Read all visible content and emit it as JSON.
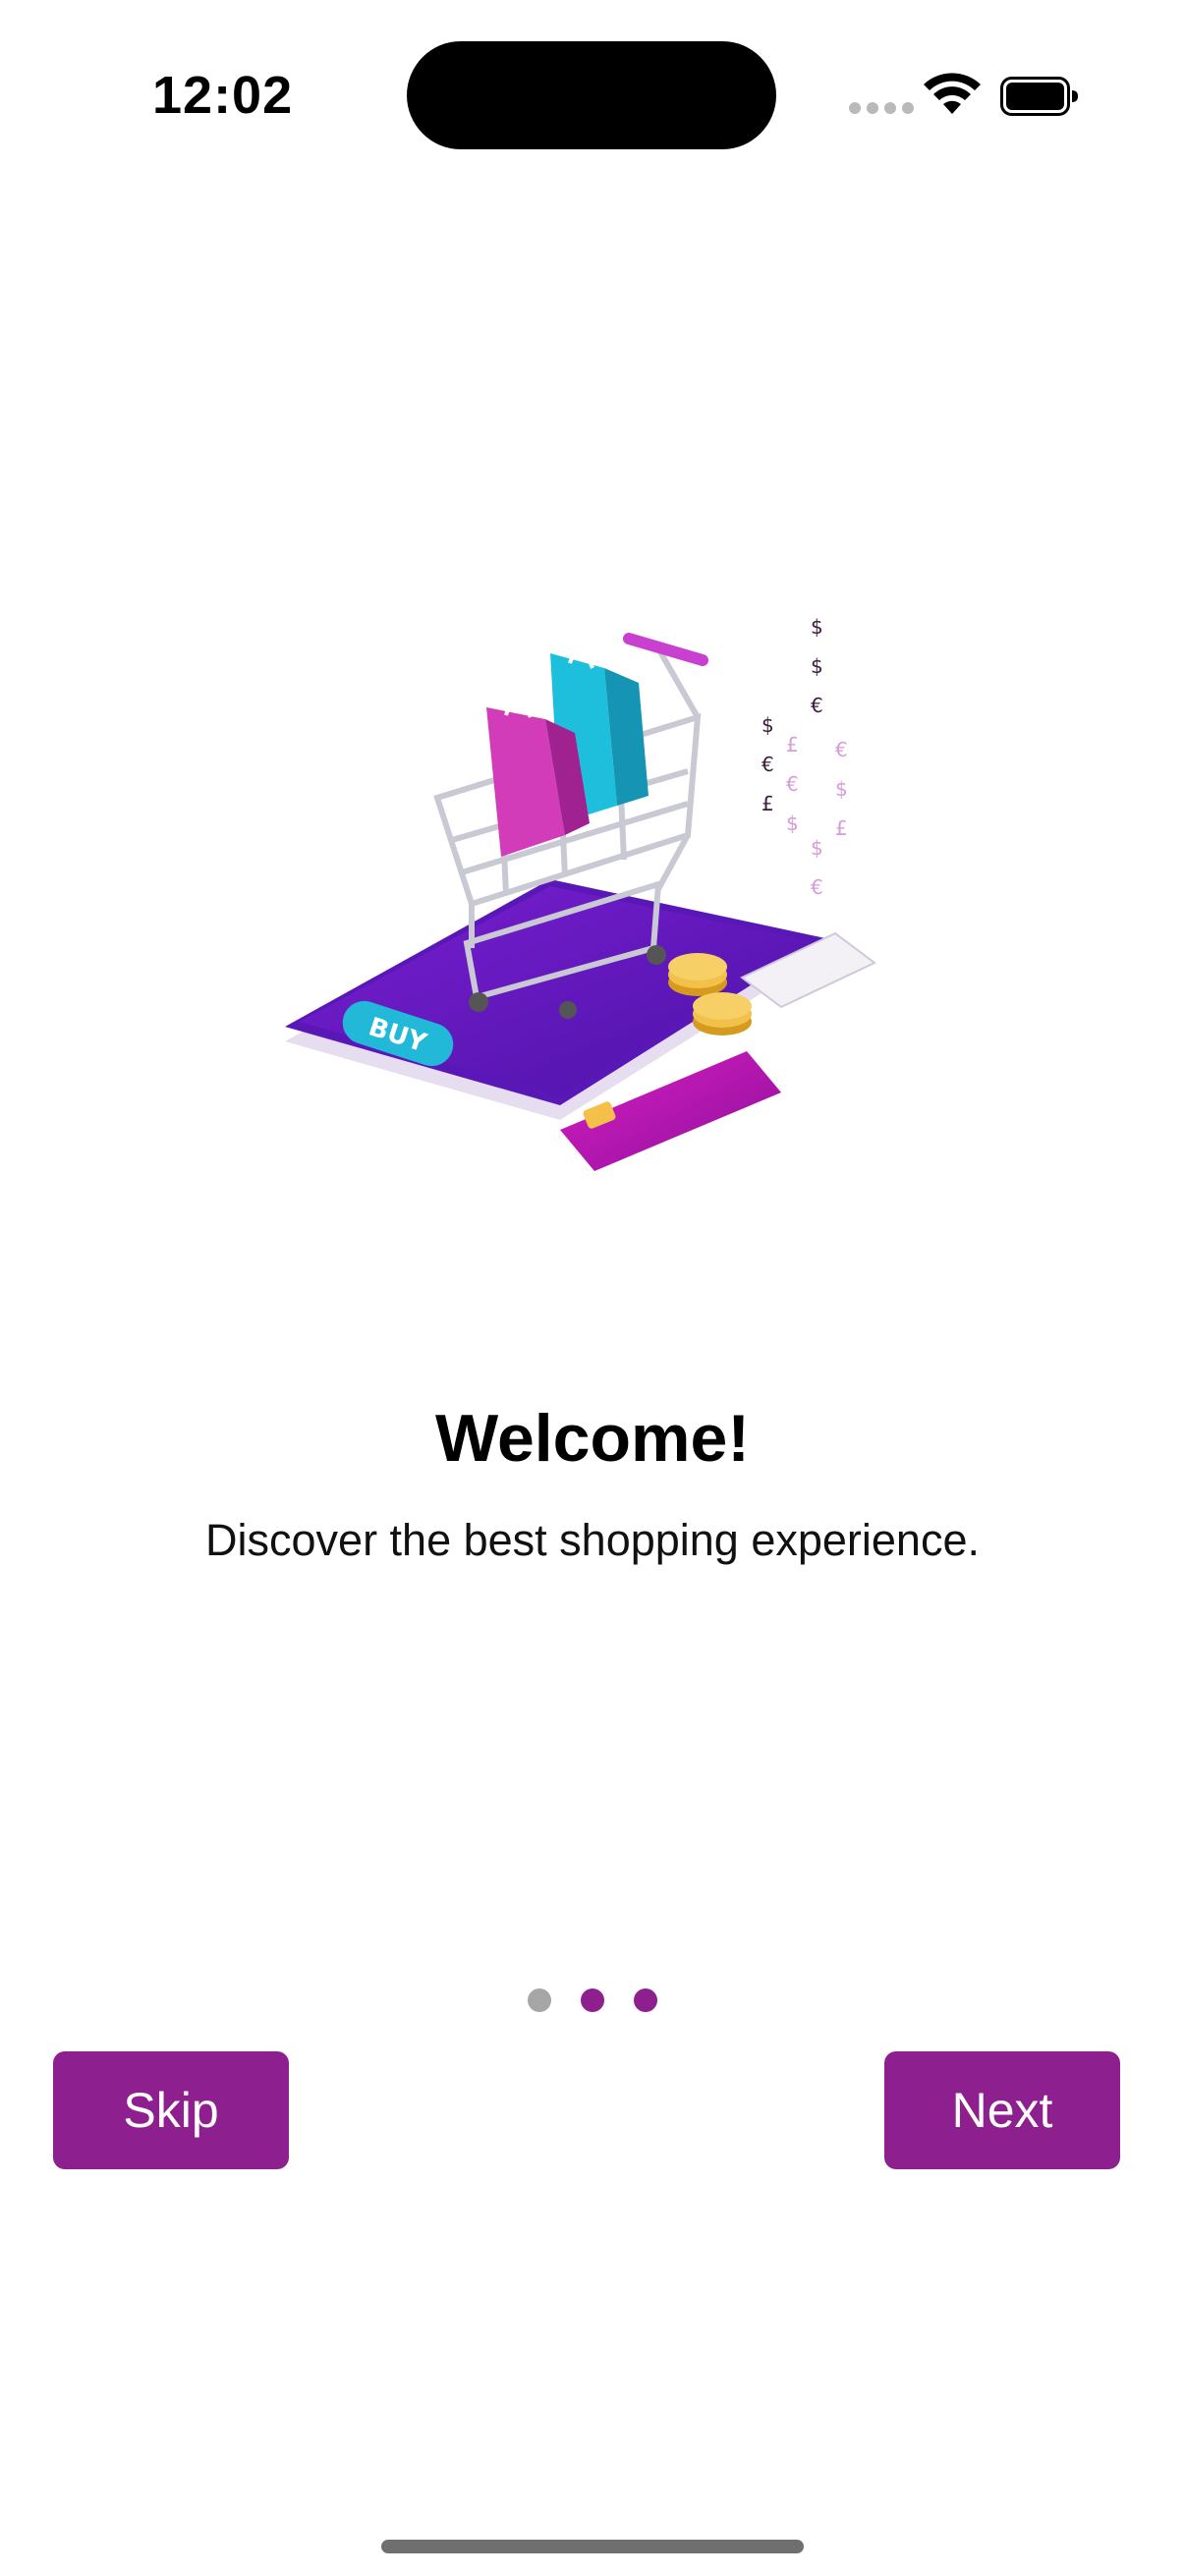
{
  "status_bar": {
    "time": "12:02"
  },
  "onboarding": {
    "hero_image_icon": "shopping-cart-phone-illustration",
    "hero_badge": "BUY",
    "title": "Welcome!",
    "subtitle": "Discover the best shopping experience."
  },
  "pager": {
    "count": 3,
    "active_index": 0,
    "colors": {
      "active": "#a6a6a6",
      "inactive": "#8e1f8f"
    }
  },
  "actions": {
    "skip_label": "Skip",
    "next_label": "Next"
  },
  "theme": {
    "accent": "#8e1f8f"
  }
}
